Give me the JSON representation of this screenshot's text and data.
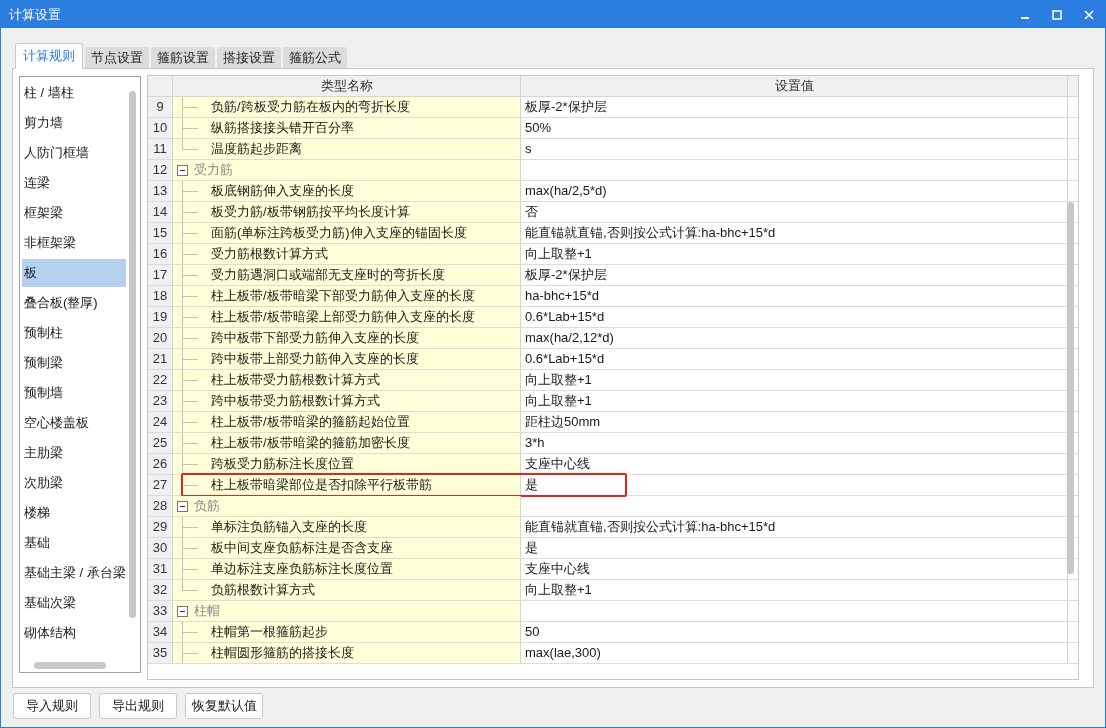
{
  "window": {
    "title": "计算设置"
  },
  "tabs": [
    {
      "label": "计算规则",
      "selected": true
    },
    {
      "label": "节点设置",
      "selected": false
    },
    {
      "label": "箍筋设置",
      "selected": false
    },
    {
      "label": "搭接设置",
      "selected": false
    },
    {
      "label": "箍筋公式",
      "selected": false
    }
  ],
  "sidebar": {
    "items": [
      {
        "label": "柱 / 墙柱",
        "selected": false
      },
      {
        "label": "剪力墙",
        "selected": false
      },
      {
        "label": "人防门框墙",
        "selected": false
      },
      {
        "label": "连梁",
        "selected": false
      },
      {
        "label": "框架梁",
        "selected": false
      },
      {
        "label": "非框架梁",
        "selected": false
      },
      {
        "label": "板",
        "selected": true
      },
      {
        "label": "叠合板(整厚)",
        "selected": false
      },
      {
        "label": "预制柱",
        "selected": false
      },
      {
        "label": "预制梁",
        "selected": false
      },
      {
        "label": "预制墙",
        "selected": false
      },
      {
        "label": "空心楼盖板",
        "selected": false
      },
      {
        "label": "主肋梁",
        "selected": false
      },
      {
        "label": "次肋梁",
        "selected": false
      },
      {
        "label": "楼梯",
        "selected": false
      },
      {
        "label": "基础",
        "selected": false
      },
      {
        "label": "基础主梁 / 承台梁",
        "selected": false
      },
      {
        "label": "基础次梁",
        "selected": false
      },
      {
        "label": "砌体结构",
        "selected": false
      }
    ]
  },
  "table": {
    "columns": [
      "类型名称",
      "设置值"
    ],
    "rows": [
      {
        "kind": "item",
        "number": "9",
        "name": "负筋/跨板受力筋在板内的弯折长度",
        "value": "板厚-2*保护层",
        "highlighted": false
      },
      {
        "kind": "item",
        "number": "10",
        "name": "纵筋搭接接头错开百分率",
        "value": "50%",
        "highlighted": false
      },
      {
        "kind": "item",
        "number": "11",
        "name": "温度筋起步距离",
        "value": "s",
        "highlighted": false,
        "last": true
      },
      {
        "kind": "group",
        "number": "12",
        "name": "受力筋",
        "expanded": true,
        "highlighted": false
      },
      {
        "kind": "item",
        "number": "13",
        "name": "板底钢筋伸入支座的长度",
        "value": "max(ha/2,5*d)",
        "highlighted": false
      },
      {
        "kind": "item",
        "number": "14",
        "name": "板受力筋/板带钢筋按平均长度计算",
        "value": "否",
        "highlighted": false
      },
      {
        "kind": "item",
        "number": "15",
        "name": "面筋(单标注跨板受力筋)伸入支座的锚固长度",
        "value": "能直锚就直锚,否则按公式计算:ha-bhc+15*d",
        "highlighted": false
      },
      {
        "kind": "item",
        "number": "16",
        "name": "受力筋根数计算方式",
        "value": "向上取整+1",
        "highlighted": false
      },
      {
        "kind": "item",
        "number": "17",
        "name": "受力筋遇洞口或端部无支座时的弯折长度",
        "value": "板厚-2*保护层",
        "highlighted": false
      },
      {
        "kind": "item",
        "number": "18",
        "name": "柱上板带/板带暗梁下部受力筋伸入支座的长度",
        "value": "ha-bhc+15*d",
        "highlighted": false
      },
      {
        "kind": "item",
        "number": "19",
        "name": "柱上板带/板带暗梁上部受力筋伸入支座的长度",
        "value": "0.6*Lab+15*d",
        "highlighted": false
      },
      {
        "kind": "item",
        "number": "20",
        "name": "跨中板带下部受力筋伸入支座的长度",
        "value": "max(ha/2,12*d)",
        "highlighted": false
      },
      {
        "kind": "item",
        "number": "21",
        "name": "跨中板带上部受力筋伸入支座的长度",
        "value": "0.6*Lab+15*d",
        "highlighted": false
      },
      {
        "kind": "item",
        "number": "22",
        "name": "柱上板带受力筋根数计算方式",
        "value": "向上取整+1",
        "highlighted": false
      },
      {
        "kind": "item",
        "number": "23",
        "name": "跨中板带受力筋根数计算方式",
        "value": "向上取整+1",
        "highlighted": false
      },
      {
        "kind": "item",
        "number": "24",
        "name": "柱上板带/板带暗梁的箍筋起始位置",
        "value": "距柱边50mm",
        "highlighted": false
      },
      {
        "kind": "item",
        "number": "25",
        "name": "柱上板带/板带暗梁的箍筋加密长度",
        "value": "3*h",
        "highlighted": false
      },
      {
        "kind": "item",
        "number": "26",
        "name": "跨板受力筋标注长度位置",
        "value": "支座中心线",
        "highlighted": false
      },
      {
        "kind": "item",
        "number": "27",
        "name": "柱上板带暗梁部位是否扣除平行板带筋",
        "value": "是",
        "highlighted": true,
        "last": true
      },
      {
        "kind": "group",
        "number": "28",
        "name": "负筋",
        "expanded": true,
        "highlighted": false
      },
      {
        "kind": "item",
        "number": "29",
        "name": "单标注负筋锚入支座的长度",
        "value": "能直锚就直锚,否则按公式计算:ha-bhc+15*d",
        "highlighted": false
      },
      {
        "kind": "item",
        "number": "30",
        "name": "板中间支座负筋标注是否含支座",
        "value": "是",
        "highlighted": false
      },
      {
        "kind": "item",
        "number": "31",
        "name": "单边标注支座负筋标注长度位置",
        "value": "支座中心线",
        "highlighted": false
      },
      {
        "kind": "item",
        "number": "32",
        "name": "负筋根数计算方式",
        "value": "向上取整+1",
        "highlighted": false,
        "last": true
      },
      {
        "kind": "group",
        "number": "33",
        "name": "柱帽",
        "expanded": true,
        "highlighted": false
      },
      {
        "kind": "item",
        "number": "34",
        "name": "柱帽第一根箍筋起步",
        "value": "50",
        "highlighted": false
      },
      {
        "kind": "item",
        "number": "35",
        "name": "柱帽圆形箍筋的搭接长度",
        "value": "max(lae,300)",
        "highlighted": false
      }
    ]
  },
  "buttons": [
    "导入规则",
    "导出规则",
    "恢复默认值"
  ]
}
